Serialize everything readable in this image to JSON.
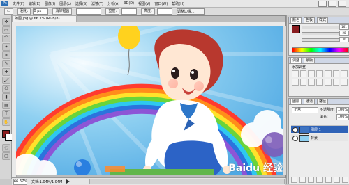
{
  "app": {
    "logo": "Ps",
    "menu": [
      "文件(F)",
      "编辑(E)",
      "图像(I)",
      "图层(L)",
      "选择(S)",
      "滤镜(T)",
      "分析(A)",
      "3D(D)",
      "视图(V)",
      "窗口(W)",
      "帮助(H)"
    ]
  },
  "options": {
    "feather_label": "羽化:",
    "feather_value": "0 px",
    "mode_label": "消除锯齿",
    "button_label": "调整边缘...",
    "width_label": "宽度:",
    "height_label": "高度:"
  },
  "document": {
    "tab_title": "如图.jpg @ 66.7% (RGB/8)",
    "zoom": "66.67%",
    "status_text": "文档:1.04M/1.04M"
  },
  "watermark": {
    "text": "Baidu 经验"
  },
  "panels": {
    "color": {
      "tabs": [
        "颜色",
        "色板",
        "样式"
      ],
      "values": [
        "161",
        "28",
        "30"
      ]
    },
    "adjust": {
      "tabs": [
        "调整",
        "蒙版"
      ],
      "title": "添加调整"
    },
    "layers": {
      "tabs": [
        "图层",
        "通道",
        "路径"
      ],
      "blend_mode": "正常",
      "opacity_label": "不透明度:",
      "opacity_value": "100%",
      "fill_label": "填充:",
      "fill_value": "100%",
      "rows": [
        {
          "label": "图层 1",
          "selected": true
        },
        {
          "label": "背景",
          "selected": false
        }
      ]
    }
  },
  "colors": {
    "fg": "#8a1d1f",
    "bg": "#ffffff",
    "accent": "#2f63b7"
  }
}
